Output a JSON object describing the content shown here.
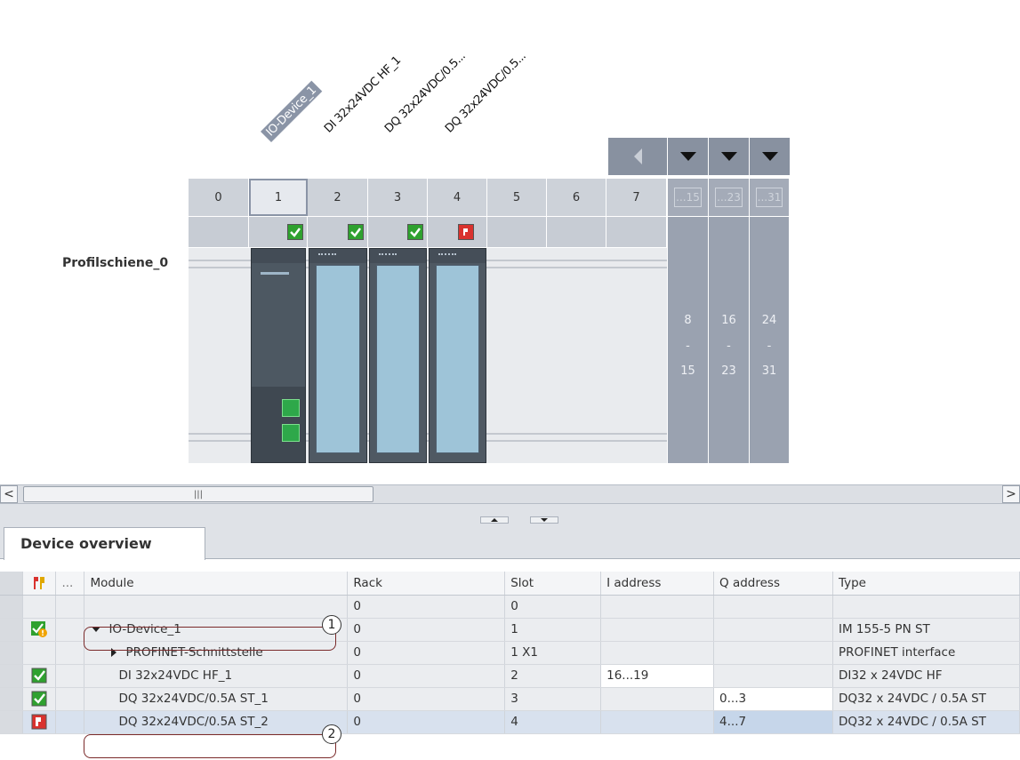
{
  "modules_header": {
    "labels": [
      "IO-Device_1",
      "DI 32x24VDC HF_1",
      "DQ 32x24VDC/0.5...",
      "DQ 32x24VDC/0.5..."
    ]
  },
  "rack": {
    "name": "Profilschiene_0",
    "slots": [
      "0",
      "1",
      "2",
      "3",
      "4",
      "5",
      "6",
      "7"
    ],
    "extension_slots": [
      "...15",
      "...23",
      "...31"
    ],
    "extension_ranges": [
      {
        "from": "8",
        "dash": "-",
        "to": "15"
      },
      {
        "from": "16",
        "dash": "-",
        "to": "23"
      },
      {
        "from": "24",
        "dash": "-",
        "to": "31"
      }
    ],
    "status_icons": [
      "ok-icon",
      "ok-icon",
      "ok-icon",
      "error-icon"
    ]
  },
  "scrollbar": {
    "thumb_grip": "|||",
    "left_arrow": "<",
    "right_arrow": ">"
  },
  "panel": {
    "tab_label": "Device overview"
  },
  "table": {
    "headers": [
      "...",
      "Module",
      "Rack",
      "Slot",
      "I address",
      "Q address",
      "Type"
    ],
    "rows": [
      {
        "status": "",
        "module": "",
        "rack": "0",
        "slot": "0",
        "iaddr": "",
        "qaddr": "",
        "type": ""
      },
      {
        "status": "ok-warning-icon",
        "module": "IO-Device_1",
        "rack": "0",
        "slot": "1",
        "iaddr": "",
        "qaddr": "",
        "type": "IM 155-5 PN ST"
      },
      {
        "status": "",
        "module": "PROFINET-Schnittstelle",
        "rack": "0",
        "slot": "1 X1",
        "iaddr": "",
        "qaddr": "",
        "type": "PROFINET interface"
      },
      {
        "status": "ok-icon",
        "module": "DI 32x24VDC HF_1",
        "rack": "0",
        "slot": "2",
        "iaddr": "16...19",
        "qaddr": "",
        "type": "DI32 x 24VDC HF"
      },
      {
        "status": "ok-icon",
        "module": "DQ 32x24VDC/0.5A ST_1",
        "rack": "0",
        "slot": "3",
        "iaddr": "",
        "qaddr": "0...3",
        "type": "DQ32 x 24VDC / 0.5A ST"
      },
      {
        "status": "error-icon",
        "module": "DQ 32x24VDC/0.5A ST_2",
        "rack": "0",
        "slot": "4",
        "iaddr": "",
        "qaddr": "4...7",
        "type": "DQ32 x 24VDC / 0.5A ST"
      }
    ]
  },
  "callouts": [
    "1",
    "2"
  ],
  "colors": {
    "ok": "#2fa12f",
    "error": "#d9322e",
    "selected_row": "#d8e1ee",
    "rack_header": "#cdd2d9"
  }
}
